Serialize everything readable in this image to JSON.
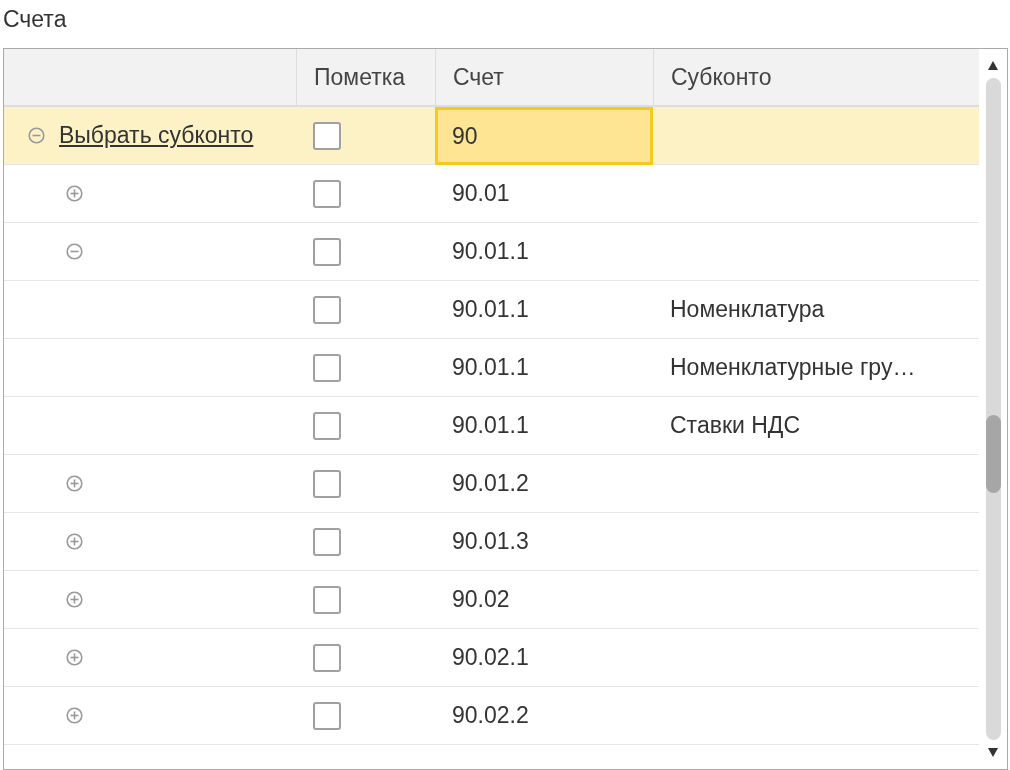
{
  "title": "Счета",
  "table": {
    "columns": [
      "Пометка",
      "Счет",
      "Субконто"
    ],
    "rows": [
      {
        "label": "Выбрать субконто",
        "checked": false,
        "account": "90",
        "selected": true,
        "expanded": true,
        "children": [
          {
            "checked": false,
            "account": "90.01",
            "selected": false,
            "expanded": false
          },
          {
            "checked": false,
            "account": "90.01.1",
            "selected": false,
            "expanded": true,
            "children": [
              {
                "checked": false,
                "account": "90.01.1",
                "subconto": "Номенклатура",
                "selected": false
              },
              {
                "checked": false,
                "account": "90.01.1",
                "subconto": "Номенклатурные гру…",
                "selected": false
              },
              {
                "checked": false,
                "account": "90.01.1",
                "subconto": "Ставки НДС",
                "selected": false
              }
            ]
          },
          {
            "checked": false,
            "account": "90.01.2",
            "selected": false,
            "expanded": false
          },
          {
            "checked": false,
            "account": "90.01.3",
            "selected": false,
            "expanded": false
          },
          {
            "checked": false,
            "account": "90.02",
            "selected": false,
            "expanded": false
          },
          {
            "checked": false,
            "account": "90.02.1",
            "selected": false,
            "expanded": false
          },
          {
            "checked": false,
            "account": "90.02.2",
            "selected": false,
            "expanded": false
          }
        ]
      }
    ]
  }
}
